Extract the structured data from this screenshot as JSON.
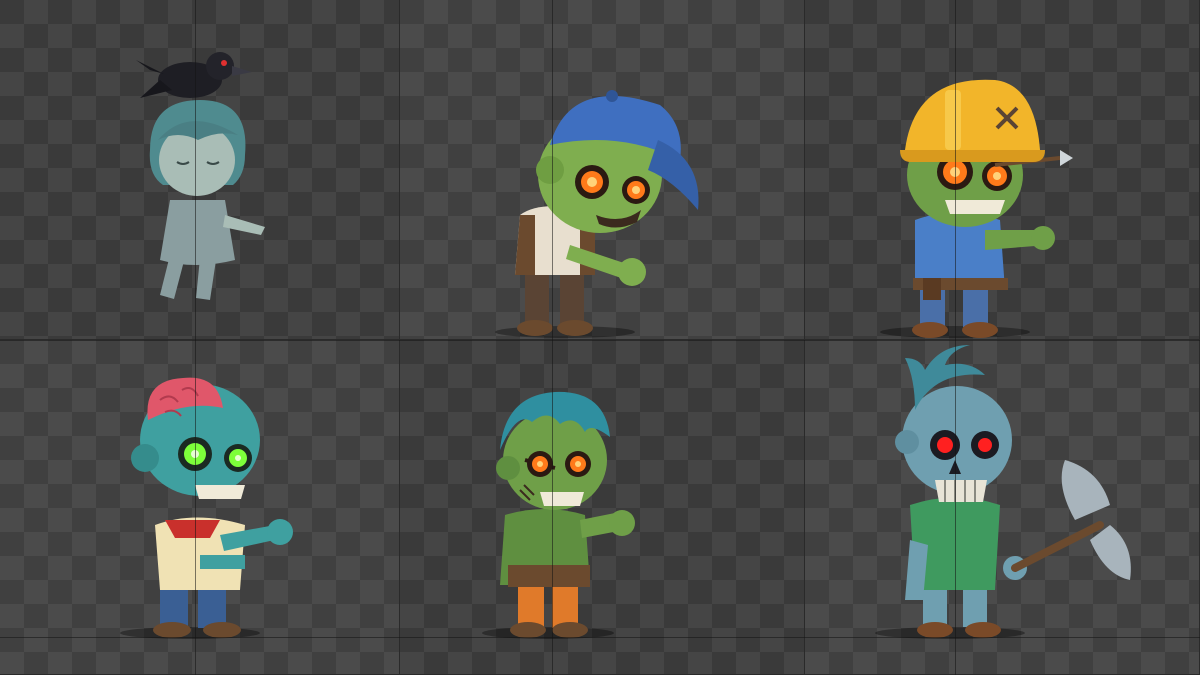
{
  "canvas": {
    "background": "#3a3a3a",
    "checker_dark": "#454545",
    "guide_color": "#1a1a1a"
  },
  "sprites": [
    {
      "id": "ghost-girl-with-crow",
      "icon": "ghost-girl-crow-icon",
      "skin": "#9fb3ad",
      "hair": "#4f8b8f"
    },
    {
      "id": "zombie-blue-cap",
      "icon": "zombie-cap-icon",
      "skin": "#7fae4f",
      "cap": "#3f6fc0",
      "eyes": "#ff7a1a"
    },
    {
      "id": "zombie-hard-hat",
      "icon": "zombie-hardhat-icon",
      "skin": "#6f9f48",
      "helmet": "#f2b52a",
      "eyes": "#ff7a1a"
    },
    {
      "id": "zombie-exposed-brain",
      "icon": "zombie-brain-icon",
      "skin": "#3fa0a0",
      "brain": "#e0576a",
      "eyes": "#7dff3a"
    },
    {
      "id": "zombie-frankenstein",
      "icon": "zombie-frank-icon",
      "skin": "#6f9f48",
      "hair": "#2f8fa0",
      "eyes": "#ff7a1a"
    },
    {
      "id": "zombie-skeleton-axe",
      "icon": "zombie-axe-icon",
      "skin": "#6f9fb0",
      "eyes": "#ff2020",
      "axe": "#a8b4bc"
    }
  ]
}
